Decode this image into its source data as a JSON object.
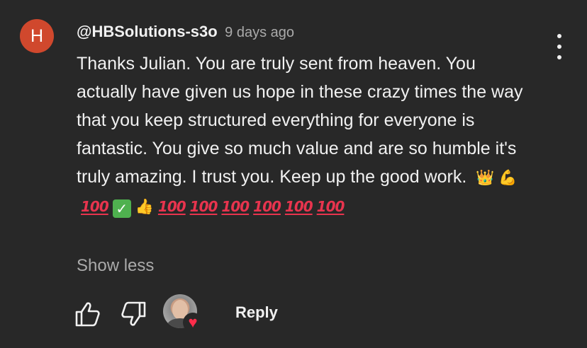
{
  "comment": {
    "avatar_letter": "H",
    "avatar_color": "#d0482d",
    "author": "@HBSolutions-s3o",
    "time": "9 days ago",
    "text": "Thanks Julian. You are truly sent from heaven. You actually have given us hope in these crazy times the way that you keep structured everything for everyone is fantastic. You give so much value and are so humble it's truly amazing. I trust you. Keep up the good work.",
    "emojis": [
      {
        "name": "crown-emoji",
        "glyph": "👑",
        "kind": "yellow"
      },
      {
        "name": "flexed-biceps-emoji",
        "glyph": "💪",
        "kind": "yellow"
      },
      {
        "name": "hundred-points-emoji",
        "glyph": "100",
        "kind": "hundred"
      },
      {
        "name": "check-mark-button-emoji",
        "glyph": "✓",
        "kind": "check"
      },
      {
        "name": "thumbs-up-emoji",
        "glyph": "👍",
        "kind": "yellow"
      },
      {
        "name": "hundred-points-emoji",
        "glyph": "100",
        "kind": "hundred"
      },
      {
        "name": "hundred-points-emoji",
        "glyph": "100",
        "kind": "hundred"
      },
      {
        "name": "hundred-points-emoji",
        "glyph": "100",
        "kind": "hundred"
      },
      {
        "name": "hundred-points-emoji",
        "glyph": "100",
        "kind": "hundred"
      },
      {
        "name": "hundred-points-emoji",
        "glyph": "100",
        "kind": "hundred"
      },
      {
        "name": "hundred-points-emoji",
        "glyph": "100",
        "kind": "hundred"
      }
    ],
    "show_less": "Show less",
    "reply": "Reply",
    "heart_color": "#ff2d4b"
  },
  "icons": {
    "menu": "more-vertical-icon",
    "like": "thumbs-up-icon",
    "dislike": "thumbs-down-icon",
    "creator_heart": "creator-heart-icon"
  }
}
